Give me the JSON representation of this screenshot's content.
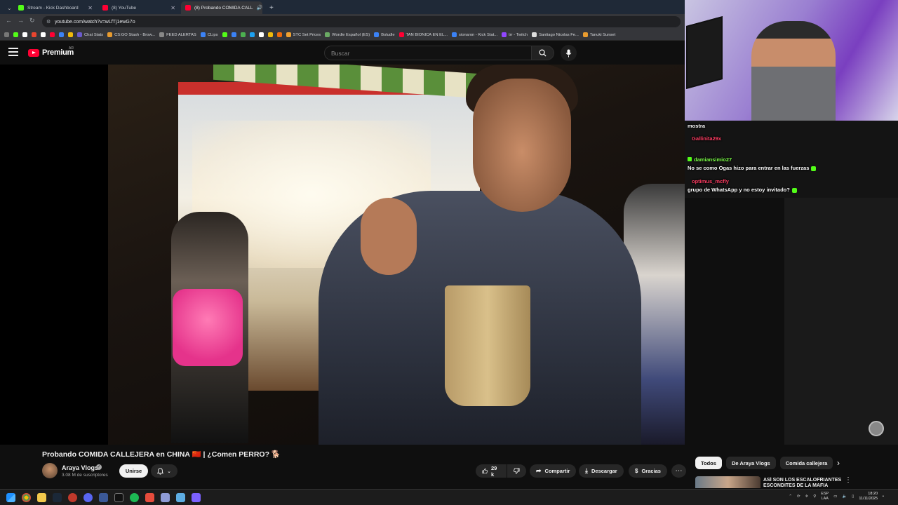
{
  "browser": {
    "tabs": [
      {
        "label": "Stream - Kick Dashboard",
        "color": "#53fc18"
      },
      {
        "label": "(8) YouTube",
        "color": "#ff0033"
      },
      {
        "label": "(8) Probando COMIDA CALL",
        "color": "#ff0033"
      }
    ],
    "url": "youtube.com/watch?v=wLfTj1ewG7o",
    "bookmarks": [
      {
        "label": "Chat Stats",
        "color": "#6a5acd"
      },
      {
        "label": "CS:GO Stash - Brow...",
        "color": "#e89b2f"
      },
      {
        "label": "FEED ALERTAS",
        "color": "#888"
      },
      {
        "label": "CLips",
        "color": "#3b82f6"
      },
      {
        "label": "STC Set Prices",
        "color": "#f0a030"
      },
      {
        "label": "Wordle Español (ES)",
        "color": "#6aaa64"
      },
      {
        "label": "Boludle",
        "color": "#3b82f6"
      },
      {
        "label": "TAN BIONICA EN EL...",
        "color": "#ff0033"
      },
      {
        "label": "sionaron - Kick Stat...",
        "color": "#3b82f6"
      },
      {
        "label": "trr - Twitch",
        "color": "#9146ff"
      },
      {
        "label": "Santiago Nicolas Fe...",
        "color": "#ddd"
      },
      {
        "label": "Tanuki Sunset",
        "color": "#e89b2f"
      }
    ]
  },
  "header": {
    "logo_text": "Premium",
    "country_code": "AR",
    "search_placeholder": "Buscar"
  },
  "chat": {
    "lines": [
      {
        "user": "",
        "text": "mostra"
      },
      {
        "user": "Gallinita29x",
        "text": ""
      },
      {
        "user": "damiansimio27",
        "text": ""
      },
      {
        "user": "",
        "text": "No se como Ogas hizo para entrar en las fuerzas"
      },
      {
        "user": "optimus_mcfly",
        "text": ""
      },
      {
        "user": "",
        "text": "grupo de WhatsApp y no estoy invitado?"
      }
    ]
  },
  "video": {
    "title": "Probando COMIDA CALLEJERA en CHINA 🇨🇳 | ¿Comen PERRO? 🐕",
    "channel": "Araya Vlogs",
    "subscribers": "3.08 M de suscriptores",
    "join_label": "Unirse",
    "likes": "29 k",
    "share_label": "Compartir",
    "download_label": "Descargar",
    "thanks_label": "Gracias"
  },
  "sidebar": {
    "chips": [
      "Todos",
      "De Araya Vlogs",
      "Comida callejera"
    ],
    "rec_title_line1": "ASÍ SON LOS ESCALOFRIANTES",
    "rec_title_line2": "ESCONDITES DE LA MAFIA"
  },
  "taskbar": {
    "lang": "ESP",
    "lang2": "LAA",
    "time": "18:20",
    "date": "11/11/2025"
  }
}
